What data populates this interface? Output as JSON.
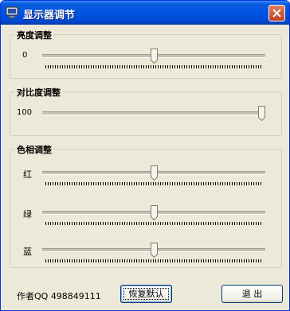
{
  "window": {
    "title": "显示器调节"
  },
  "brightness": {
    "title": "亮度调整",
    "value": "0",
    "position": 0.5
  },
  "contrast": {
    "title": "对比度调整",
    "value": "100",
    "position": 1.0
  },
  "hue": {
    "title": "色相调整",
    "red": {
      "label": "红",
      "position": 0.5
    },
    "green": {
      "label": "绿",
      "position": 0.5
    },
    "blue": {
      "label": "蓝",
      "position": 0.5
    }
  },
  "footer": {
    "author": "作者QQ 498849111",
    "reset_label": "恢复默认",
    "exit_label": "退 出"
  }
}
